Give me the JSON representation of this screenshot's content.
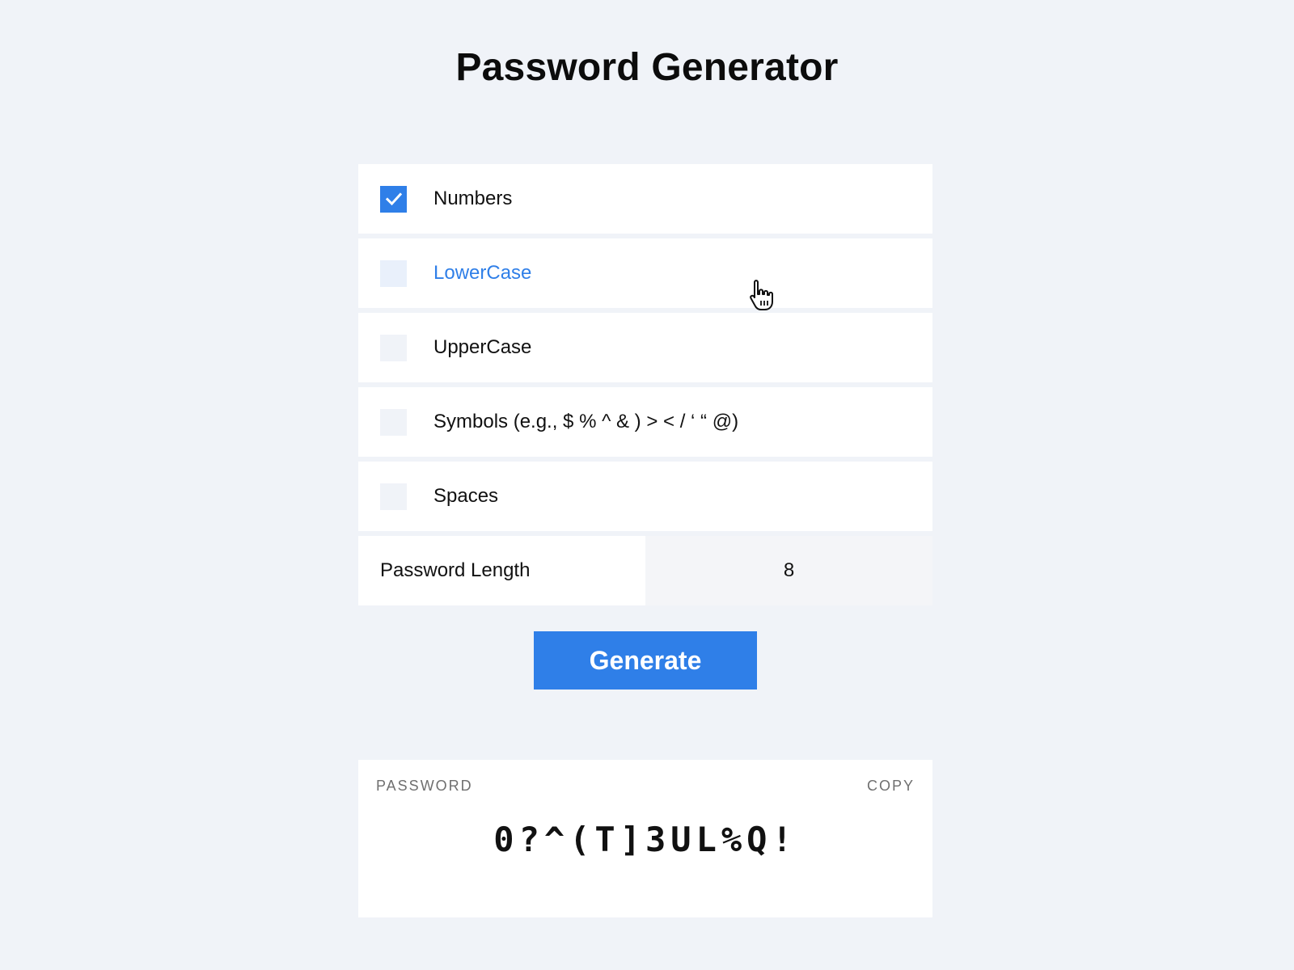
{
  "title": "Password Generator",
  "options": [
    {
      "label": "Numbers",
      "checked": true,
      "hovered": false
    },
    {
      "label": "LowerCase",
      "checked": false,
      "hovered": true
    },
    {
      "label": "UpperCase",
      "checked": false,
      "hovered": false
    },
    {
      "label": "Symbols (e.g., $ % ^ & ) > < / ‘ “ @)",
      "checked": false,
      "hovered": false
    },
    {
      "label": "Spaces",
      "checked": false,
      "hovered": false
    }
  ],
  "length": {
    "label": "Password Length",
    "value": "8"
  },
  "generate_label": "Generate",
  "result": {
    "caption": "PASSWORD",
    "copy_label": "COPY",
    "password": "0?^(T]3UL%Q!"
  },
  "colors": {
    "accent": "#2f7fe8",
    "background": "#f0f3f8",
    "card": "#ffffff"
  },
  "icons": {
    "checkmark": "check-icon",
    "cursor": "hand-pointer-icon"
  }
}
